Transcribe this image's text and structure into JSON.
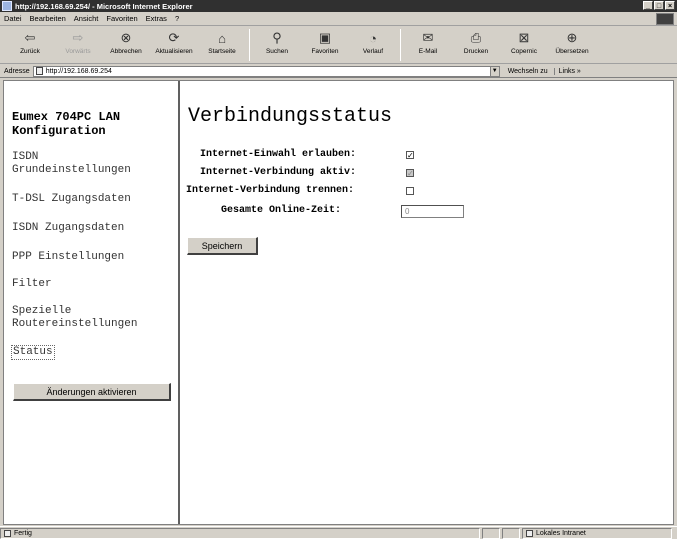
{
  "window": {
    "title": "http://192.168.69.254/ - Microsoft Internet Explorer"
  },
  "menu": [
    "Datei",
    "Bearbeiten",
    "Ansicht",
    "Favoriten",
    "Extras",
    "?"
  ],
  "toolbar": {
    "back": "Zurück",
    "forward": "Vorwärts",
    "stop": "Abbrechen",
    "refresh": "Aktualisieren",
    "home": "Startseite",
    "search": "Suchen",
    "favorites": "Favoriten",
    "history": "Verlauf",
    "mail": "E-Mail",
    "print": "Drucken",
    "copernic": "Copernic",
    "translate": "Übersetzen"
  },
  "address": {
    "label": "Adresse",
    "url": "http://192.168.69.254",
    "go": "Wechseln zu",
    "links": "Links »"
  },
  "sidebar": {
    "brand_line1": "Eumex 704PC LAN",
    "brand_line2": "Konfiguration",
    "items": [
      {
        "line1": "ISDN",
        "line2": "Grundeinstellungen"
      },
      {
        "line1": "T-DSL Zugangsdaten"
      },
      {
        "line1": "ISDN Zugangsdaten"
      },
      {
        "line1": "PPP Einstellungen"
      },
      {
        "line1": "Filter"
      },
      {
        "line1": "Spezielle",
        "line2": "Routereinstellungen"
      },
      {
        "line1": "Status"
      }
    ],
    "apply_button": "Änderungen aktivieren"
  },
  "main": {
    "title": "Verbindungsstatus",
    "rows": {
      "einwahl_label": "Internet-Einwahl erlauben:",
      "einwahl_checked": true,
      "aktiv_label": "Internet-Verbindung aktiv:",
      "aktiv_checked": true,
      "trennen_label": "Internet-Verbindung trennen:",
      "trennen_checked": false,
      "online_label": "Gesamte Online-Zeit:",
      "online_value": "0"
    },
    "save_button": "Speichern"
  },
  "statusbar": {
    "status": "Fertig",
    "zone": "Lokales Intranet"
  }
}
